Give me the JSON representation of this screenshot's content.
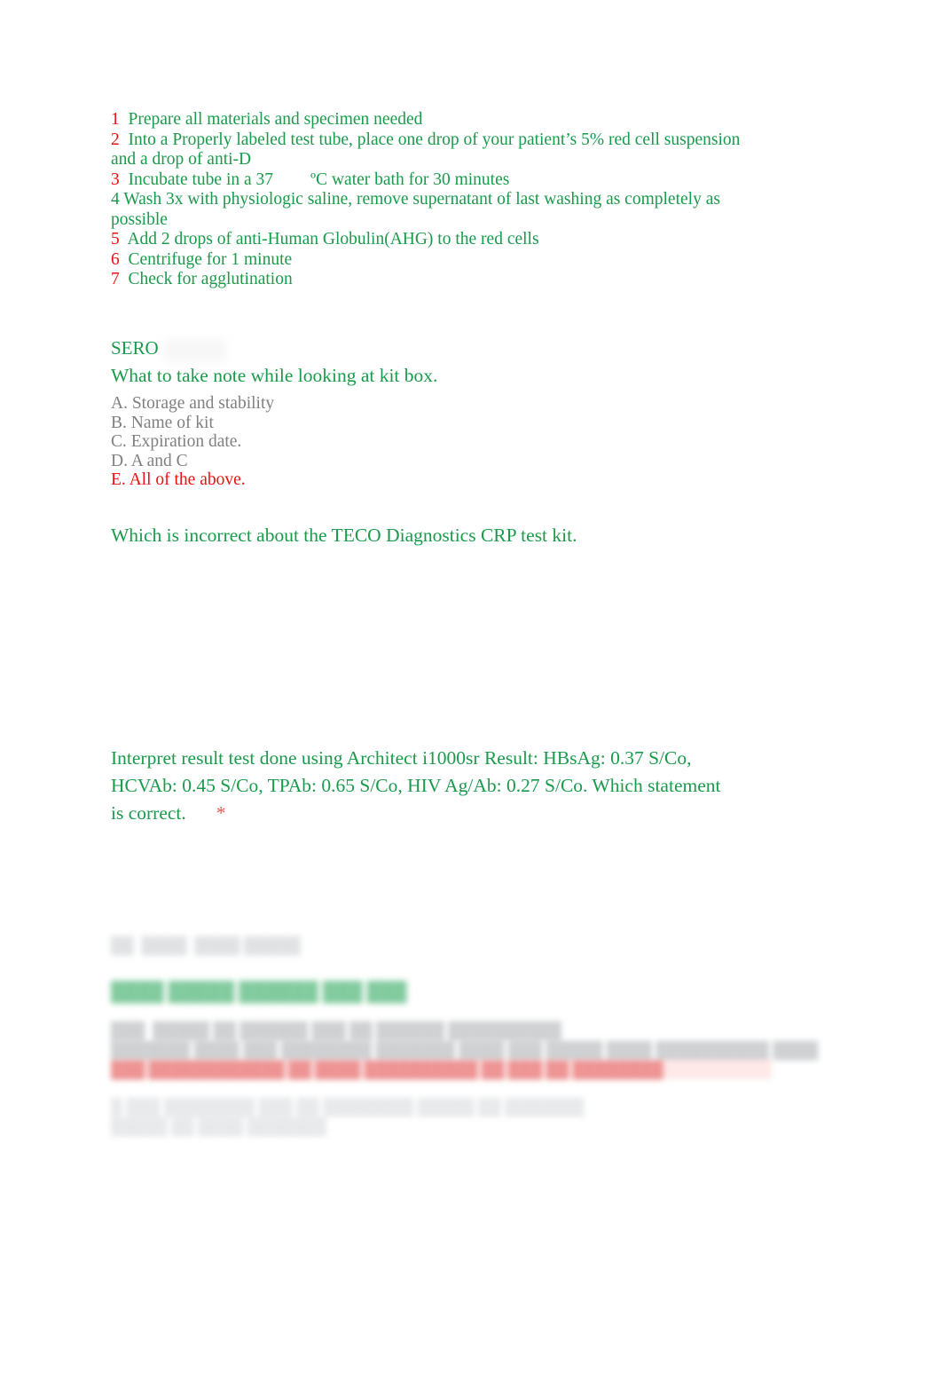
{
  "document": {
    "background_color": "#ffffff",
    "text_colors": {
      "green": "#1a9b4c",
      "red": "#ee1111",
      "gray": "#808080",
      "asterisk_red": "#e8564f"
    }
  },
  "procedure": {
    "steps": [
      {
        "number": "1",
        "number_color": "red",
        "text": "Prepare all materials and specimen needed"
      },
      {
        "number": "2",
        "number_color": "red",
        "text": "Into a Properly labeled test tube, place one drop of your patient’s 5% red cell suspension and a drop of anti-D"
      },
      {
        "number": "3",
        "number_color": "red",
        "text_before": "Incubate tube in a 37",
        "degree": "ºC",
        "text_after": " water bath for 30 minutes"
      },
      {
        "number": "4",
        "number_color": "green",
        "text": "Wash 3x with physiologic saline, remove supernatant of last washing as completely as possible"
      },
      {
        "number": "5",
        "number_color": "red",
        "text": "Add 2 drops of anti-Human Globulin(AHG) to the red cells"
      },
      {
        "number": "6",
        "number_color": "red",
        "text": "Centrifuge for 1 minute"
      },
      {
        "number": "7",
        "number_color": "red",
        "text": "Check for agglutination"
      }
    ]
  },
  "sero_section": {
    "heading": "SERO",
    "question": "What to take note while looking at kit box.",
    "options": [
      {
        "label": "A. Storage and stability",
        "color": "gray"
      },
      {
        "label": "B. Name of kit",
        "color": "gray"
      },
      {
        "label": "C. Expiration date.",
        "color": "gray"
      },
      {
        "label": "D. A and C",
        "color": "gray"
      },
      {
        "label": "E. All of the above.",
        "color": "red"
      }
    ]
  },
  "teco_question": {
    "text": "Which is incorrect about the TECO Diagnostics CRP test kit."
  },
  "architect_question": {
    "text": "Interpret result test done using Architect i1000sr Result: HBsAg: 0.37 S/Co, HCVAb: 0.45 S/Co, TPAb: 0.65 S/Co, HIV Ag/Ab: 0.27 S/Co. Which statement is correct.",
    "required_marker": "*"
  },
  "redacted_section": {
    "note": "Bottom region is blurred and illegible in the source image.",
    "lines": [
      {
        "style": "faint",
        "placeholder": "██  ████  ████ █████"
      },
      {
        "style": "green",
        "placeholder": "████ █████ ██████ ███ ███"
      },
      {
        "style": "gray",
        "placeholder": "███  █████ ██ ██████ ███ ██ ██████ ██████████"
      },
      {
        "style": "gray",
        "placeholder": "███████ ████ ███ ████████ ███████ ████ ███ █████ ████ ██████████ ████"
      },
      {
        "style": "redhl",
        "placeholder": "███ ████████████ ██ ████ ██████████ ██ ███ ██ ████████"
      },
      {
        "style": "vfaint",
        "placeholder": "█ ███ ████████ ███ ██ ████████ █████ ██ ███████"
      },
      {
        "style": "vfaint",
        "placeholder": "█████ ██ ████ ███████"
      }
    ]
  }
}
